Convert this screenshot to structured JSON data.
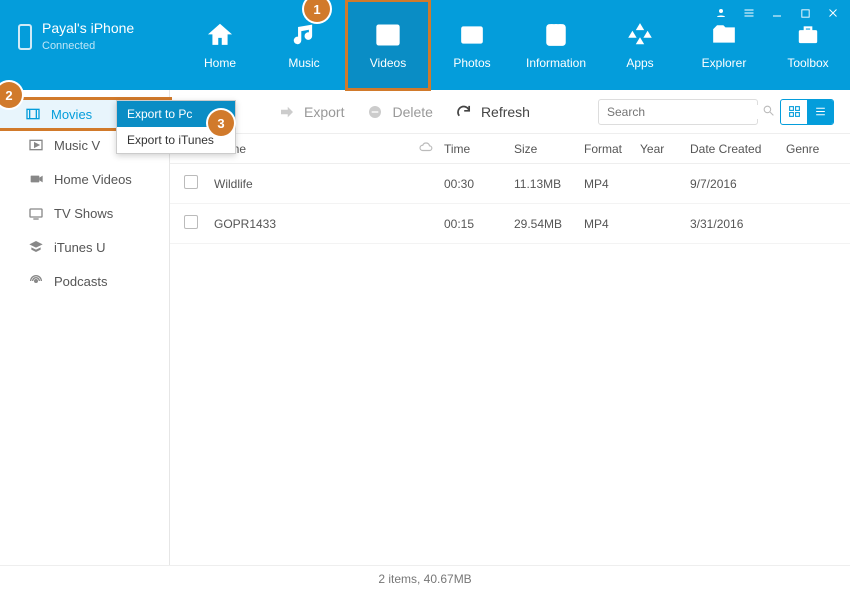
{
  "device": {
    "name": "Payal's iPhone",
    "status": "Connected"
  },
  "nav": {
    "home": "Home",
    "music": "Music",
    "videos": "Videos",
    "photos": "Photos",
    "information": "Information",
    "apps": "Apps",
    "explorer": "Explorer",
    "toolbox": "Toolbox"
  },
  "sidebar": {
    "movies": "Movies",
    "musicvideos": "Music V",
    "homevideos": "Home Videos",
    "tvshows": "TV Shows",
    "itunesu": "iTunes U",
    "podcasts": "Podcasts"
  },
  "toolbar": {
    "export": "Export",
    "delete": "Delete",
    "refresh": "Refresh",
    "search_placeholder": "Search"
  },
  "export_menu": {
    "pc": "Export to Pc",
    "itunes": "Export to iTunes"
  },
  "columns": {
    "name": "Name",
    "time": "Time",
    "size": "Size",
    "format": "Format",
    "year": "Year",
    "date": "Date Created",
    "genre": "Genre"
  },
  "rows": [
    {
      "name": "Wildlife",
      "time": "00:30",
      "size": "11.13MB",
      "format": "MP4",
      "year": "",
      "date": "9/7/2016",
      "genre": ""
    },
    {
      "name": "GOPR1433",
      "time": "00:15",
      "size": "29.54MB",
      "format": "MP4",
      "year": "",
      "date": "3/31/2016",
      "genre": ""
    }
  ],
  "status": "2 items, 40.67MB",
  "callouts": {
    "c1": "1",
    "c2": "2",
    "c3": "3"
  }
}
